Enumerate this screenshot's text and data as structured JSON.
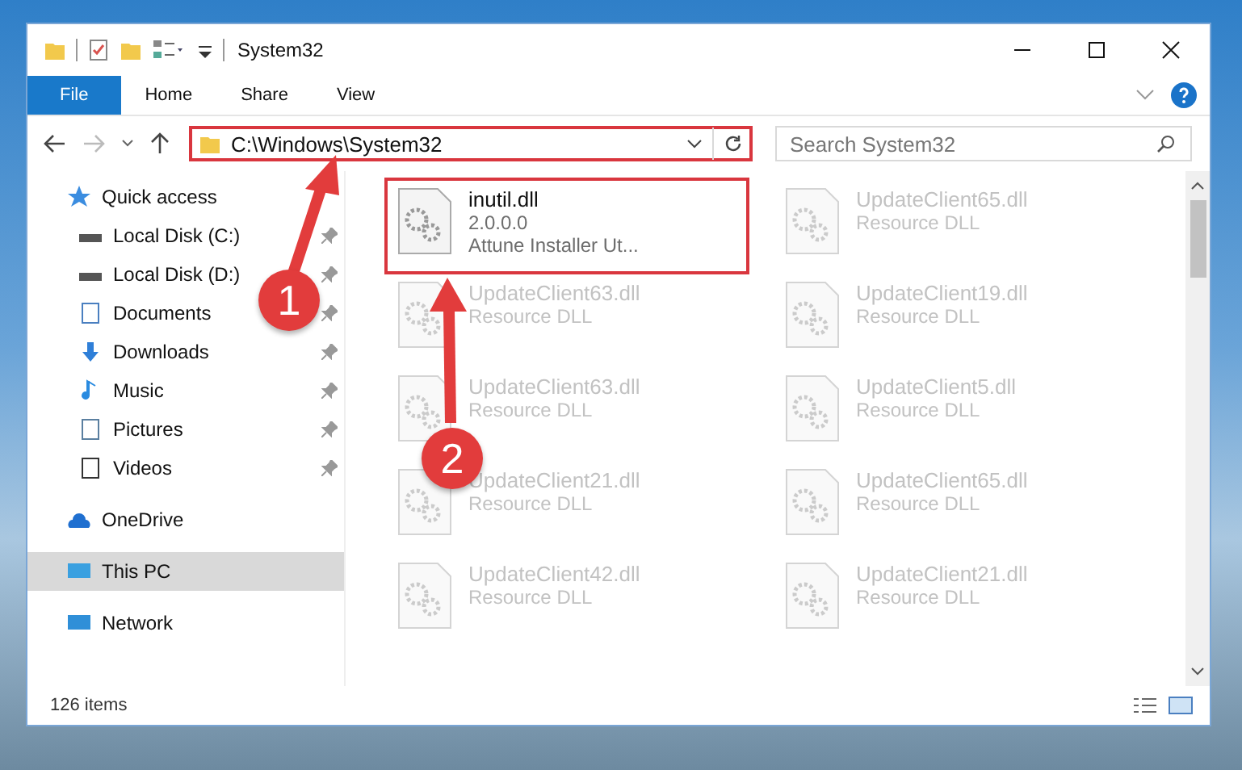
{
  "window": {
    "title": "System32"
  },
  "ribbon_tabs": [
    {
      "label": "File",
      "selected": true
    },
    {
      "label": "Home",
      "selected": false
    },
    {
      "label": "Share",
      "selected": false
    },
    {
      "label": "View",
      "selected": false
    }
  ],
  "address": {
    "path": "C:\\Windows\\System32",
    "highlighted": true
  },
  "search": {
    "placeholder": "Search System32"
  },
  "sidebar": {
    "items": [
      {
        "label": "Quick access",
        "kind": "star",
        "selected": false,
        "children": [
          {
            "label": "Local Disk (C:)",
            "kind": "drive",
            "pinned": true,
            "selected": false
          },
          {
            "label": "Local Disk (D:)",
            "kind": "drive",
            "pinned": true,
            "selected": false
          },
          {
            "label": "Documents",
            "kind": "document",
            "pinned": true,
            "selected": false
          },
          {
            "label": "Downloads",
            "kind": "download",
            "pinned": true,
            "selected": false
          },
          {
            "label": "Music",
            "kind": "music",
            "pinned": true,
            "selected": false
          },
          {
            "label": "Pictures",
            "kind": "picture",
            "pinned": true,
            "selected": false
          },
          {
            "label": "Videos",
            "kind": "video",
            "pinned": true,
            "selected": false
          }
        ]
      },
      {
        "label": "OneDrive",
        "kind": "cloud",
        "selected": false
      },
      {
        "label": "This PC",
        "kind": "computer",
        "selected": true
      },
      {
        "label": "Network",
        "kind": "network",
        "selected": false
      }
    ]
  },
  "files": [
    {
      "name": "inutil.dll",
      "lines": [
        "2.0.0.0",
        "Attune Installer Ut..."
      ],
      "blurred": false,
      "highlighted": true
    },
    {
      "name": "UpdateClient65.dll",
      "lines": [
        "Resource DLL"
      ],
      "blurred": true,
      "highlighted": false
    },
    {
      "name": "UpdateClient63.dll",
      "lines": [
        "Resource DLL"
      ],
      "blurred": true,
      "highlighted": false
    },
    {
      "name": "UpdateClient19.dll",
      "lines": [
        "Resource DLL"
      ],
      "blurred": true,
      "highlighted": false
    },
    {
      "name": "UpdateClient63.dll",
      "lines": [
        "Resource DLL"
      ],
      "blurred": true,
      "highlighted": false
    },
    {
      "name": "UpdateClient5.dll",
      "lines": [
        "Resource DLL"
      ],
      "blurred": true,
      "highlighted": false
    },
    {
      "name": "UpdateClient21.dll",
      "lines": [
        "Resource DLL"
      ],
      "blurred": true,
      "highlighted": false
    },
    {
      "name": "UpdateClient65.dll",
      "lines": [
        "Resource DLL"
      ],
      "blurred": true,
      "highlighted": false
    },
    {
      "name": "UpdateClient42.dll",
      "lines": [
        "Resource DLL"
      ],
      "blurred": true,
      "highlighted": false
    },
    {
      "name": "UpdateClient21.dll",
      "lines": [
        "Resource DLL"
      ],
      "blurred": true,
      "highlighted": false
    }
  ],
  "status_bar": {
    "count": "126 items"
  },
  "annotations": [
    {
      "label": "1"
    },
    {
      "label": "2"
    }
  ]
}
